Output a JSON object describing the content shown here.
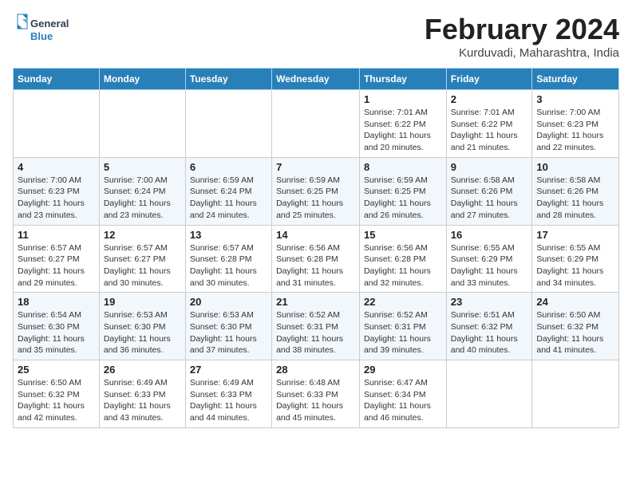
{
  "header": {
    "logo_general": "General",
    "logo_blue": "Blue",
    "month_title": "February 2024",
    "location": "Kurduvadi, Maharashtra, India"
  },
  "weekdays": [
    "Sunday",
    "Monday",
    "Tuesday",
    "Wednesday",
    "Thursday",
    "Friday",
    "Saturday"
  ],
  "weeks": [
    [
      {
        "day": "",
        "info": ""
      },
      {
        "day": "",
        "info": ""
      },
      {
        "day": "",
        "info": ""
      },
      {
        "day": "",
        "info": ""
      },
      {
        "day": "1",
        "info": "Sunrise: 7:01 AM\nSunset: 6:22 PM\nDaylight: 11 hours and 20 minutes."
      },
      {
        "day": "2",
        "info": "Sunrise: 7:01 AM\nSunset: 6:22 PM\nDaylight: 11 hours and 21 minutes."
      },
      {
        "day": "3",
        "info": "Sunrise: 7:00 AM\nSunset: 6:23 PM\nDaylight: 11 hours and 22 minutes."
      }
    ],
    [
      {
        "day": "4",
        "info": "Sunrise: 7:00 AM\nSunset: 6:23 PM\nDaylight: 11 hours and 23 minutes."
      },
      {
        "day": "5",
        "info": "Sunrise: 7:00 AM\nSunset: 6:24 PM\nDaylight: 11 hours and 23 minutes."
      },
      {
        "day": "6",
        "info": "Sunrise: 6:59 AM\nSunset: 6:24 PM\nDaylight: 11 hours and 24 minutes."
      },
      {
        "day": "7",
        "info": "Sunrise: 6:59 AM\nSunset: 6:25 PM\nDaylight: 11 hours and 25 minutes."
      },
      {
        "day": "8",
        "info": "Sunrise: 6:59 AM\nSunset: 6:25 PM\nDaylight: 11 hours and 26 minutes."
      },
      {
        "day": "9",
        "info": "Sunrise: 6:58 AM\nSunset: 6:26 PM\nDaylight: 11 hours and 27 minutes."
      },
      {
        "day": "10",
        "info": "Sunrise: 6:58 AM\nSunset: 6:26 PM\nDaylight: 11 hours and 28 minutes."
      }
    ],
    [
      {
        "day": "11",
        "info": "Sunrise: 6:57 AM\nSunset: 6:27 PM\nDaylight: 11 hours and 29 minutes."
      },
      {
        "day": "12",
        "info": "Sunrise: 6:57 AM\nSunset: 6:27 PM\nDaylight: 11 hours and 30 minutes."
      },
      {
        "day": "13",
        "info": "Sunrise: 6:57 AM\nSunset: 6:28 PM\nDaylight: 11 hours and 30 minutes."
      },
      {
        "day": "14",
        "info": "Sunrise: 6:56 AM\nSunset: 6:28 PM\nDaylight: 11 hours and 31 minutes."
      },
      {
        "day": "15",
        "info": "Sunrise: 6:56 AM\nSunset: 6:28 PM\nDaylight: 11 hours and 32 minutes."
      },
      {
        "day": "16",
        "info": "Sunrise: 6:55 AM\nSunset: 6:29 PM\nDaylight: 11 hours and 33 minutes."
      },
      {
        "day": "17",
        "info": "Sunrise: 6:55 AM\nSunset: 6:29 PM\nDaylight: 11 hours and 34 minutes."
      }
    ],
    [
      {
        "day": "18",
        "info": "Sunrise: 6:54 AM\nSunset: 6:30 PM\nDaylight: 11 hours and 35 minutes."
      },
      {
        "day": "19",
        "info": "Sunrise: 6:53 AM\nSunset: 6:30 PM\nDaylight: 11 hours and 36 minutes."
      },
      {
        "day": "20",
        "info": "Sunrise: 6:53 AM\nSunset: 6:30 PM\nDaylight: 11 hours and 37 minutes."
      },
      {
        "day": "21",
        "info": "Sunrise: 6:52 AM\nSunset: 6:31 PM\nDaylight: 11 hours and 38 minutes."
      },
      {
        "day": "22",
        "info": "Sunrise: 6:52 AM\nSunset: 6:31 PM\nDaylight: 11 hours and 39 minutes."
      },
      {
        "day": "23",
        "info": "Sunrise: 6:51 AM\nSunset: 6:32 PM\nDaylight: 11 hours and 40 minutes."
      },
      {
        "day": "24",
        "info": "Sunrise: 6:50 AM\nSunset: 6:32 PM\nDaylight: 11 hours and 41 minutes."
      }
    ],
    [
      {
        "day": "25",
        "info": "Sunrise: 6:50 AM\nSunset: 6:32 PM\nDaylight: 11 hours and 42 minutes."
      },
      {
        "day": "26",
        "info": "Sunrise: 6:49 AM\nSunset: 6:33 PM\nDaylight: 11 hours and 43 minutes."
      },
      {
        "day": "27",
        "info": "Sunrise: 6:49 AM\nSunset: 6:33 PM\nDaylight: 11 hours and 44 minutes."
      },
      {
        "day": "28",
        "info": "Sunrise: 6:48 AM\nSunset: 6:33 PM\nDaylight: 11 hours and 45 minutes."
      },
      {
        "day": "29",
        "info": "Sunrise: 6:47 AM\nSunset: 6:34 PM\nDaylight: 11 hours and 46 minutes."
      },
      {
        "day": "",
        "info": ""
      },
      {
        "day": "",
        "info": ""
      }
    ]
  ]
}
